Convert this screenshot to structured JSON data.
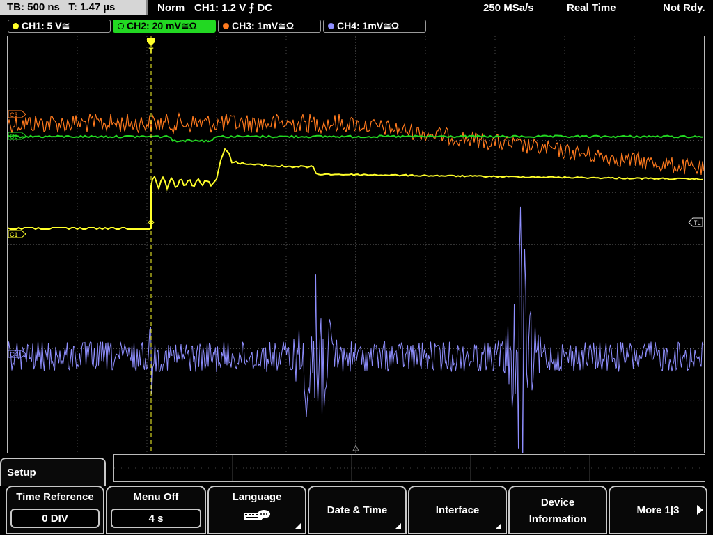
{
  "status": {
    "timebase": "TB: 500 ns",
    "trigger_time": "T: 1.47 µs",
    "mode": "Norm",
    "trigger_source": "CH1: 1.2 V ⨍ DC",
    "sample_rate": "250 MSa/s",
    "acq_mode": "Real Time",
    "state": "Not Rdy."
  },
  "channels": [
    {
      "label": "CH1: 5 V≅",
      "color": "#ffff2a",
      "marker": "C1",
      "active": false
    },
    {
      "label": "CH2: 20 mV≅Ω",
      "color": "#22d822",
      "marker": "C2",
      "active": true
    },
    {
      "label": "CH3: 1mV≅Ω",
      "color": "#ff7a1e",
      "marker": "C3",
      "active": false
    },
    {
      "label": "CH4: 1mV≅Ω",
      "color": "#8f8fff",
      "marker": "C4",
      "active": false
    }
  ],
  "markers": {
    "trigger_level": "TL",
    "trigger_pos": "T"
  },
  "menu": {
    "title": "Setup",
    "softkeys": [
      {
        "label": "Time Reference",
        "value": "0 DIV"
      },
      {
        "label": "Menu Off",
        "value": "4 s"
      },
      {
        "label": "Language",
        "icon": "keyboard-speech-icon"
      },
      {
        "label": "Date & Time"
      },
      {
        "label": "Interface"
      },
      {
        "label_line1": "Device",
        "label_line2": "Information"
      },
      {
        "label": "More 1|3"
      }
    ]
  },
  "colors": {
    "grid": "#4a4a4a",
    "ch1": "#ffff2a",
    "ch2": "#22d822",
    "ch3": "#ff7a1e",
    "ch4": "#8f8fff",
    "tab_active": "#22d822"
  }
}
